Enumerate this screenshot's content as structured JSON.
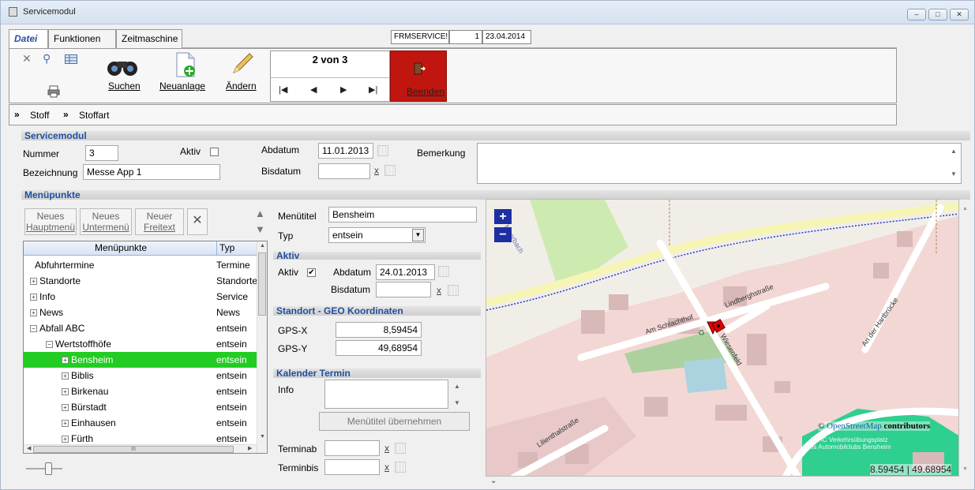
{
  "window": {
    "title": "Servicemodul",
    "controls": [
      "–",
      "□",
      "✕"
    ]
  },
  "menu": {
    "tabs": [
      "Datei",
      "Funktionen",
      "Zeitmaschine"
    ],
    "session_code": "FRMSERVICE!",
    "session_num": "1",
    "session_date": "23.04.2014"
  },
  "toolbar": {
    "search_label": "Suchen",
    "new_label": "Neuanlage",
    "edit_label": "Ändern",
    "record_position": "2 von 3",
    "nav_first": "|◀",
    "nav_prev": "◀",
    "nav_next": "▶",
    "nav_last": "▶|",
    "exit_label": "Beenden"
  },
  "breadcrumb": {
    "items": [
      "Stoff",
      "Stoffart"
    ],
    "arrow": "»"
  },
  "servicemodul": {
    "heading": "Servicemodul",
    "nummer_label": "Nummer",
    "nummer_value": "3",
    "aktiv_label": "Aktiv",
    "bezeichnung_label": "Bezeichnung",
    "bezeichnung_value": "Messe App 1",
    "abdatum_label": "Abdatum",
    "abdatum_value": "11.01.2013",
    "bisdatum_label": "Bisdatum",
    "bisdatum_value": "",
    "bemerkung_label": "Bemerkung",
    "bemerkung_value": ""
  },
  "menuepunkte": {
    "heading": "Menüpunkte",
    "btn_new_main_1": "Neues",
    "btn_new_main_2": "Hauptmenü",
    "btn_new_sub_1": "Neues",
    "btn_new_sub_2": "Untermenü",
    "btn_new_free_1": "Neuer",
    "btn_new_free_2": "Freitext",
    "col_name": "Menüpunkte",
    "col_type": "Typ",
    "rows": [
      {
        "name": "Abfuhrtermine",
        "type": "Termine",
        "expander": ""
      },
      {
        "name": "Standorte",
        "type": "Standorte",
        "expander": "+"
      },
      {
        "name": "Info",
        "type": "Service",
        "expander": "+"
      },
      {
        "name": "News",
        "type": "News",
        "expander": "+"
      },
      {
        "name": "Abfall ABC",
        "type": "entsein",
        "expander": "−"
      },
      {
        "name": "Wertstoffhöfe",
        "type": "entsein",
        "expander": "−"
      },
      {
        "name": "Bensheim",
        "type": "entsein",
        "expander": "+"
      },
      {
        "name": "Biblis",
        "type": "entsein",
        "expander": "+"
      },
      {
        "name": "Birkenau",
        "type": "entsein",
        "expander": "+"
      },
      {
        "name": "Bürstadt",
        "type": "entsein",
        "expander": "+"
      },
      {
        "name": "Einhausen",
        "type": "entsein",
        "expander": "+"
      },
      {
        "name": "Fürth",
        "type": "entsein",
        "expander": "+"
      }
    ],
    "hscroll_marker": "III"
  },
  "detail": {
    "titel_label": "Menütitel",
    "titel_value": "Bensheim",
    "typ_label": "Typ",
    "typ_value": "entsein",
    "aktiv_heading": "Aktiv",
    "aktiv_label": "Aktiv",
    "aktiv_check": "✔",
    "abdatum_label": "Abdatum",
    "abdatum_value": "24.01.2013",
    "bisdatum_label": "Bisdatum",
    "bisdatum_value": "",
    "geo_heading": "Standort - GEO Koordinaten",
    "gpsx_label": "GPS-X",
    "gpsx_value": "8,59454",
    "gpsy_label": "GPS-Y",
    "gpsy_value": "49,68954",
    "kalender_heading": "Kalender Termin",
    "info_label": "Info",
    "info_value": "",
    "apply_button": "Menütitel übernehmen",
    "terminab_label": "Terminab",
    "terminbis_label": "Terminbis",
    "clear_x": "x"
  },
  "map": {
    "zoom_in": "+",
    "zoom_out": "−",
    "attribution_prefix": "© ",
    "attribution_link": "OpenStreetMap",
    "attribution_suffix": " contributors",
    "coords": "8.59454 | 49.68954",
    "streets": [
      "Lindberghstraße",
      "Am Schlachthof",
      "Wiesenfeld",
      "An der Hartbrücke",
      "Lilienthalstraße",
      "Meerbach"
    ],
    "poi": "ADAC Verkehrsübungsplatz des Automobilclubs Bensheim",
    "marker_color": "#e00000"
  }
}
